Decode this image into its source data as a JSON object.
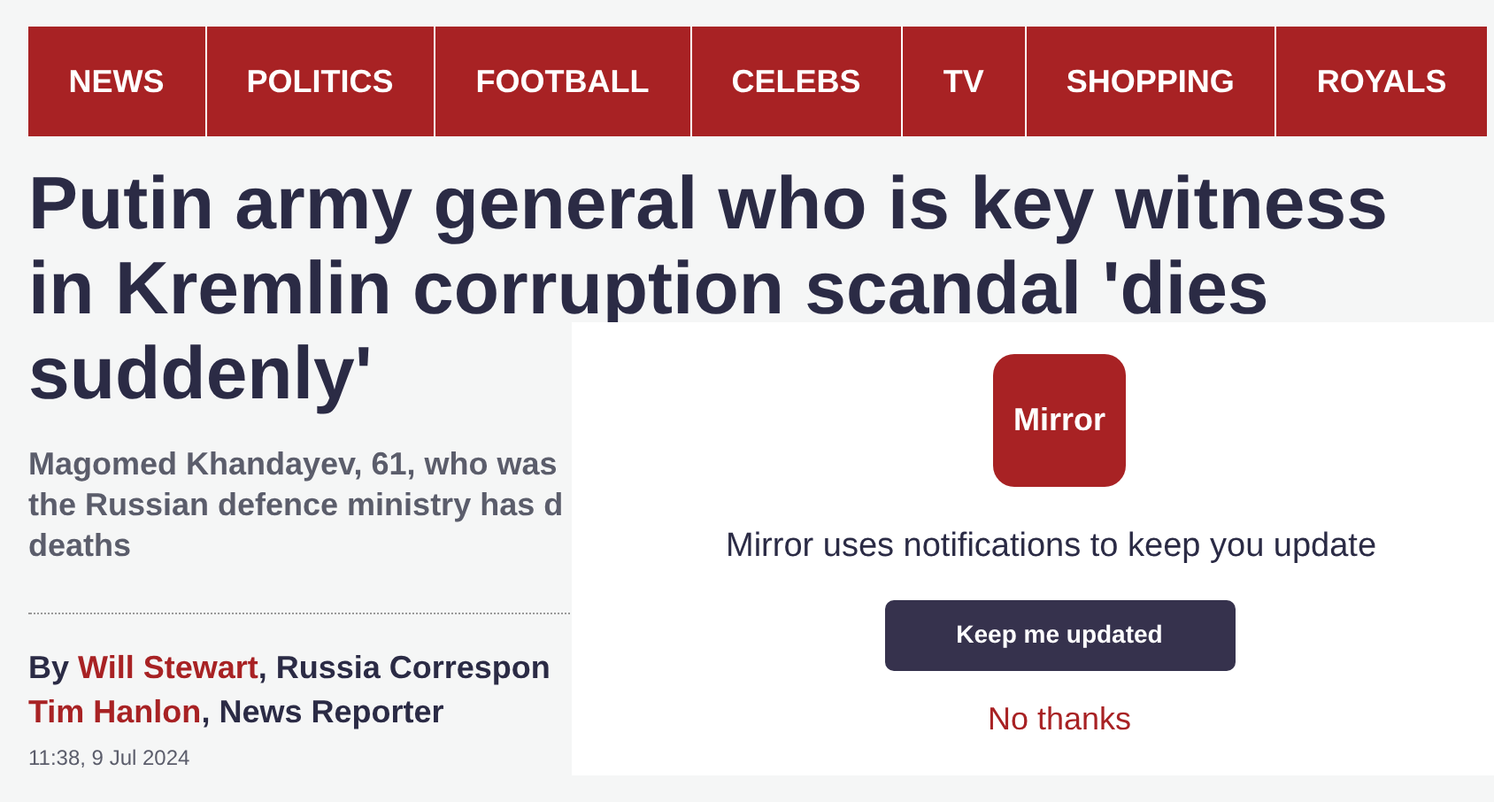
{
  "nav": [
    {
      "label": "NEWS"
    },
    {
      "label": "POLITICS"
    },
    {
      "label": "FOOTBALL"
    },
    {
      "label": "CELEBS"
    },
    {
      "label": "TV"
    },
    {
      "label": "SHOPPING"
    },
    {
      "label": "ROYALS"
    }
  ],
  "headline_lines": [
    "Putin army general who is key witness",
    "in Kremlin corruption scandal 'dies",
    "suddenly'"
  ],
  "standfirst_lines": [
    "Magomed Khandayev, 61, who was",
    "the Russian defence ministry has d",
    "deaths"
  ],
  "byline": {
    "prefix": "By ",
    "authors": [
      {
        "name": "Will Stewart",
        "role": ", Russia Correspon"
      },
      {
        "name": "Tim Hanlon",
        "role": ", News Reporter"
      }
    ]
  },
  "timestamp": "11:38, 9 Jul 2024",
  "popup": {
    "logo": "Mirror",
    "message": "Mirror uses notifications to keep you update",
    "accept": "Keep me updated",
    "decline": "No thanks"
  }
}
